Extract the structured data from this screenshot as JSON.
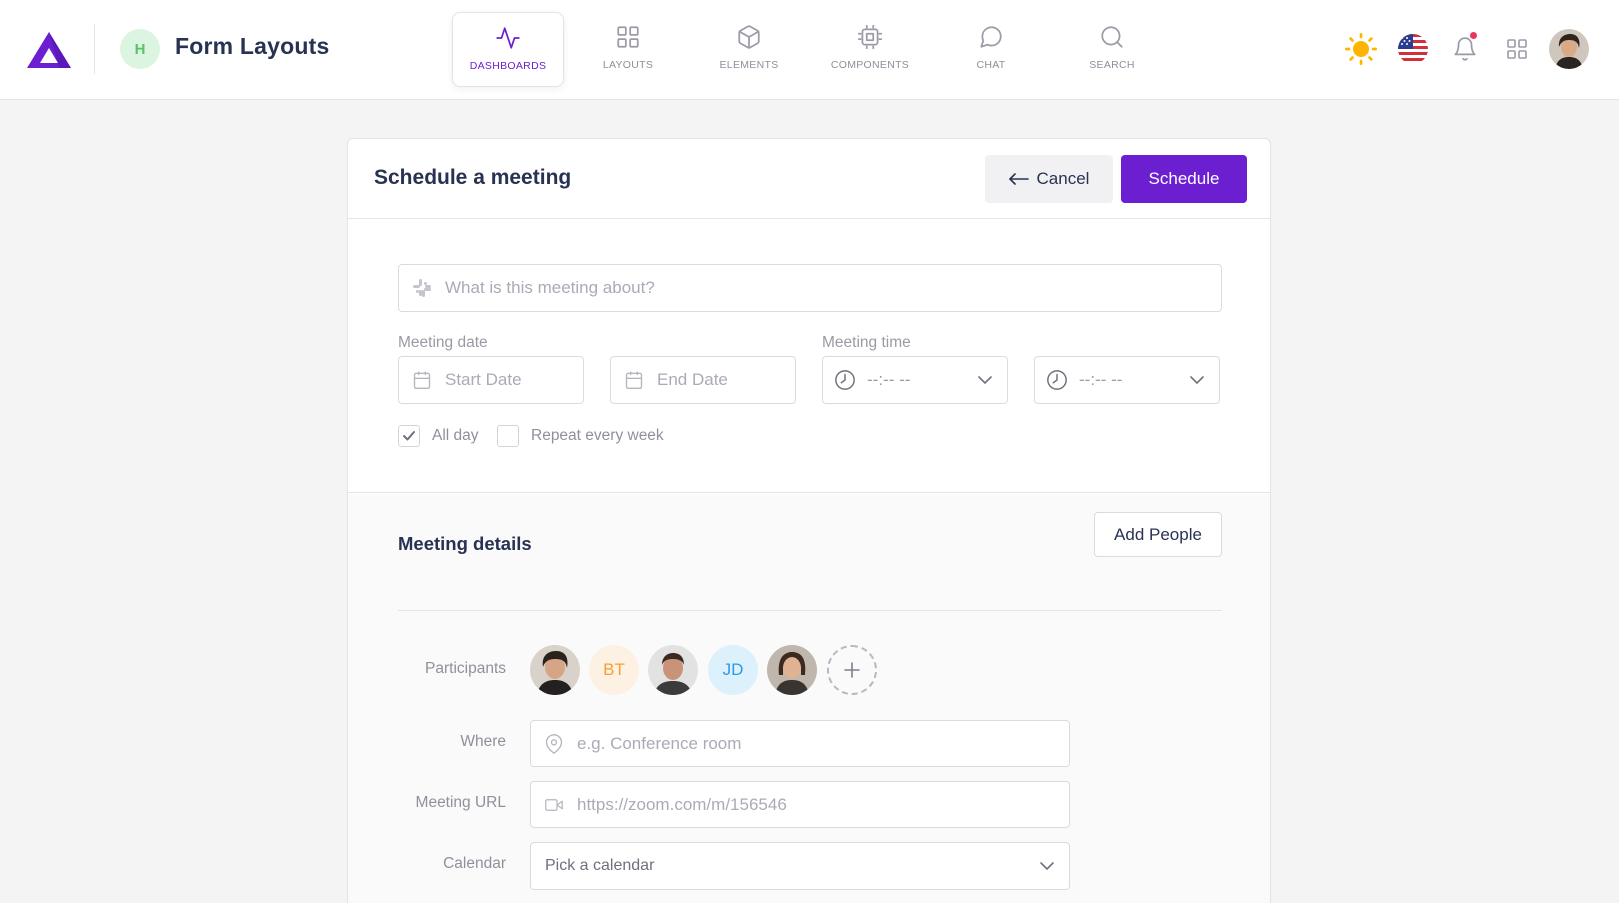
{
  "header": {
    "page_initial": "H",
    "page_title": "Form Layouts",
    "tabs": [
      {
        "label": "DASHBOARDS",
        "icon": "activity-icon",
        "active": true
      },
      {
        "label": "LAYOUTS",
        "icon": "grid-icon",
        "active": false
      },
      {
        "label": "ELEMENTS",
        "icon": "box-icon",
        "active": false
      },
      {
        "label": "COMPONENTS",
        "icon": "cpu-icon",
        "active": false
      },
      {
        "label": "CHAT",
        "icon": "message-circle-icon",
        "active": false
      },
      {
        "label": "SEARCH",
        "icon": "search-icon",
        "active": false
      }
    ],
    "right_icons": [
      "sun-icon",
      "us-flag-icon",
      "bell-icon",
      "apps-grid-icon"
    ],
    "colors": {
      "accent": "#6b1fd1",
      "sun": "#ffb400",
      "notification": "#e6375a"
    }
  },
  "form": {
    "title": "Schedule a meeting",
    "cancel_label": "Cancel",
    "schedule_label": "Schedule",
    "topic_placeholder": "What is this meeting about?",
    "meeting_date_label": "Meeting date",
    "start_date_placeholder": "Start Date",
    "end_date_placeholder": "End Date",
    "meeting_time_label": "Meeting time",
    "start_time_value": "--:-- --",
    "end_time_value": "--:-- --",
    "all_day_label": "All day",
    "all_day_checked": true,
    "repeat_label": "Repeat every week",
    "repeat_checked": false
  },
  "details": {
    "title": "Meeting details",
    "add_people_label": "Add People",
    "participants_label": "Participants",
    "participants": [
      {
        "type": "photo",
        "initials": ""
      },
      {
        "type": "initials",
        "initials": "BT",
        "bg": "#fdf1e3",
        "fg": "#f5a034"
      },
      {
        "type": "photo",
        "initials": ""
      },
      {
        "type": "initials",
        "initials": "JD",
        "bg": "#ddf1fc",
        "fg": "#2c9ae0"
      },
      {
        "type": "photo",
        "initials": ""
      }
    ],
    "where_label": "Where",
    "where_placeholder": "e.g. Conference room",
    "url_label": "Meeting URL",
    "url_placeholder": "https://zoom.com/m/156546",
    "calendar_label": "Calendar",
    "calendar_value": "Pick a calendar"
  }
}
